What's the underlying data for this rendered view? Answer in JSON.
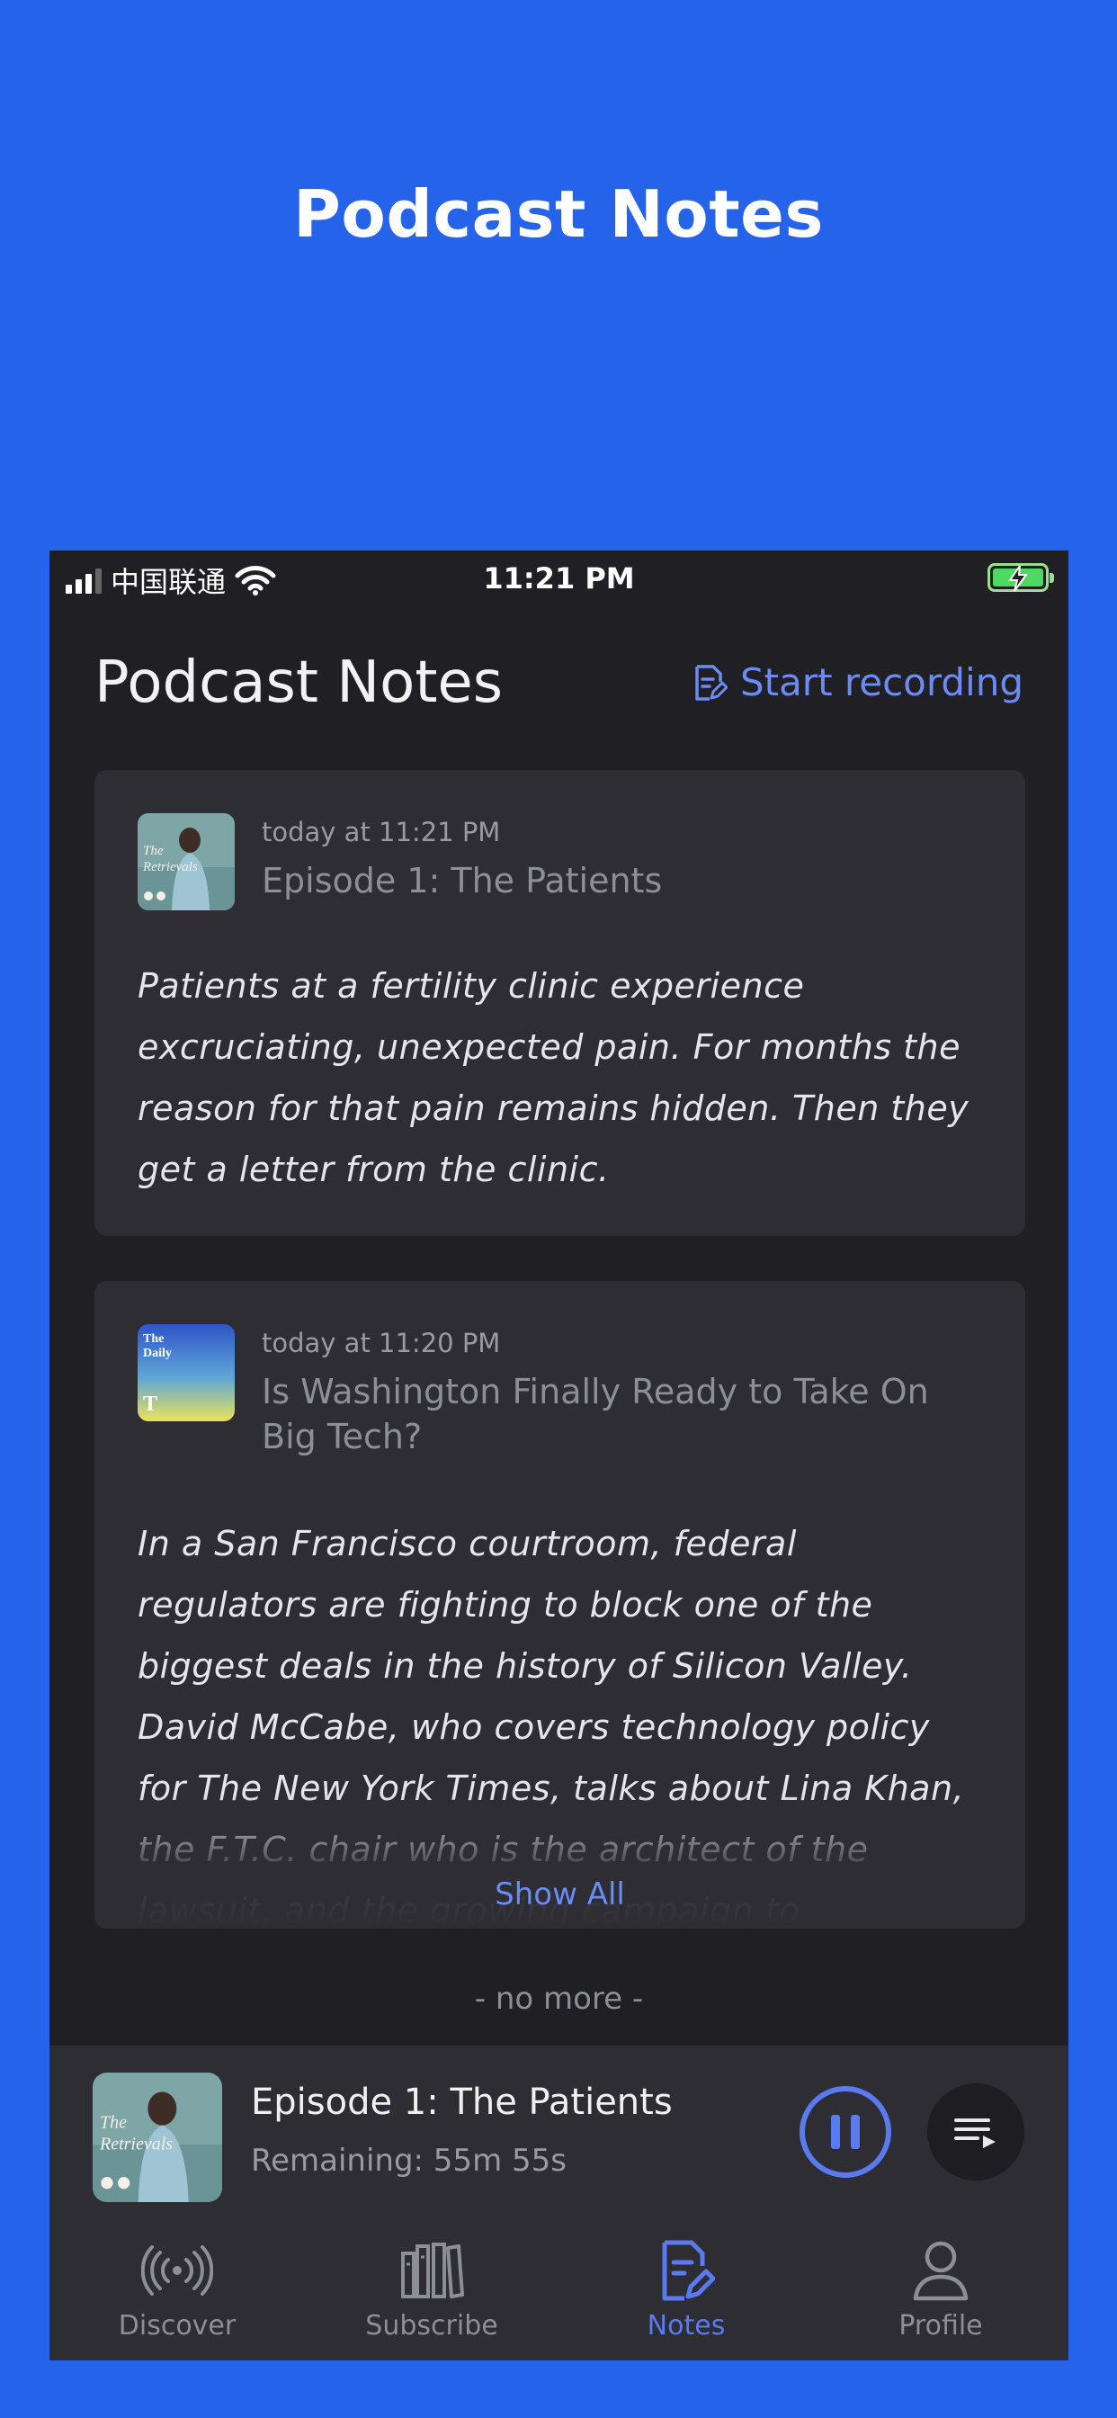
{
  "hero": {
    "title": "Podcast Notes"
  },
  "status_bar": {
    "carrier": "中国联通",
    "time": "11:21 PM"
  },
  "header": {
    "title": "Podcast Notes",
    "record_label": "Start recording"
  },
  "notes": [
    {
      "timestamp": "today at 11:21 PM",
      "episode": "Episode 1: The Patients",
      "artwork_text": "The Retrievals",
      "body": "Patients at a fertility clinic experience excruciating, unexpected pain. For months the reason for that pain remains hidden. Then they get a letter from the clinic."
    },
    {
      "timestamp": "today at 11:20 PM",
      "episode": "Is Washington Finally Ready to Take On Big Tech?",
      "artwork_text": "The Daily",
      "body": "In a San Francisco courtroom, federal regulators are fighting to block one of the biggest deals in the history of Silicon Valley. David McCabe, who covers technology policy for The New York Times, talks about Lina Khan, the F.T.C. chair who is the architect of the lawsuit, and the growing campaign to",
      "show_all_label": "Show All"
    }
  ],
  "list_end": "- no more -",
  "player": {
    "title": "Episode 1: The Patients",
    "remaining": "Remaining: 55m 55s",
    "artwork_text": "The Retrievals"
  },
  "tabs": [
    {
      "label": "Discover",
      "icon": "broadcast-icon",
      "active": false
    },
    {
      "label": "Subscribe",
      "icon": "library-icon",
      "active": false
    },
    {
      "label": "Notes",
      "icon": "notes-icon",
      "active": true
    },
    {
      "label": "Profile",
      "icon": "person-icon",
      "active": false
    }
  ],
  "colors": {
    "background": "#2563EB",
    "accent": "#5A7BF0",
    "screen": "#1F1F24",
    "card": "#2D2D33"
  }
}
